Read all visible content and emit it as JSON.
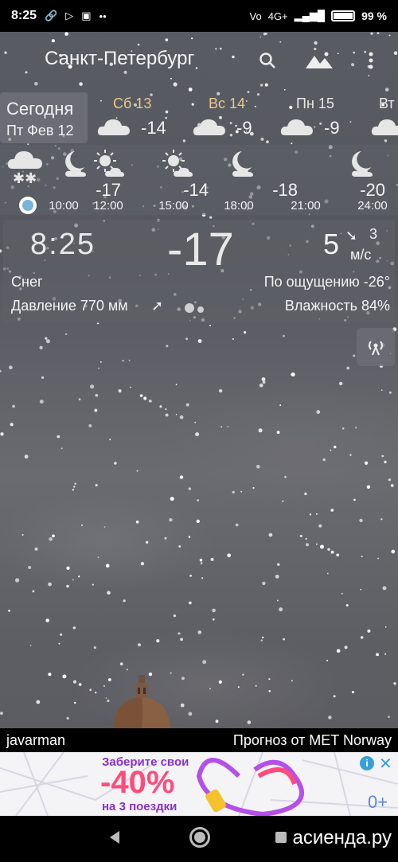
{
  "status_bar": {
    "time": "8:25",
    "network": "4G+",
    "battery": "99 %"
  },
  "toolbar": {
    "city": "Санкт-Петербург",
    "icons": [
      "search-icon",
      "landscape-icon",
      "more-vert-icon"
    ]
  },
  "days": {
    "today_label": "Сегодня",
    "today_date": "Пт Фев 12",
    "items": [
      {
        "name": "Сб 13",
        "temp": "-14",
        "weekend": true
      },
      {
        "name": "Вс 14",
        "temp": "-9",
        "weekend": true
      },
      {
        "name": "Пн 15",
        "temp": "-9",
        "weekend": false
      },
      {
        "name": "Вт",
        "temp": "",
        "weekend": false
      }
    ]
  },
  "hourly": [
    {
      "time": "10:00",
      "temp": "",
      "icon": "snow-cloud-icon"
    },
    {
      "time": "12:00",
      "temp": "-17",
      "icon": "sun-cloud-icon"
    },
    {
      "time": "15:00",
      "temp": "-14",
      "icon": "sun-cloud-icon"
    },
    {
      "time": "18:00",
      "temp": "",
      "icon": "moon-cloud-icon"
    },
    {
      "time": "21:00",
      "temp": "-18",
      "icon": "moon-cloud-icon"
    },
    {
      "time": "24:00",
      "temp": "-20",
      "icon": "moon-cloud-icon"
    }
  ],
  "current": {
    "time": "8:25",
    "temp": "-17",
    "wind_speed": "5",
    "wind_gust": "3",
    "wind_unit": "м/с",
    "condition": "Снег",
    "feels_like": "По ощущению -26°",
    "pressure": "Давление 770 мм",
    "humidity": "Влажность 84%"
  },
  "footer": {
    "user": "javarman",
    "source": "Прогноз от MET Norway"
  },
  "ad": {
    "line1": "Заберите свои",
    "line2": "-40%",
    "line3": "на 3 поездки",
    "age": "0+",
    "info": "i",
    "close": "✕"
  },
  "watermark": "асиенда.ру",
  "colors": {
    "weekend": "#e9c98a",
    "now_dot": "#7ab4d6",
    "ad_purple": "#8a2fd1",
    "ad_pink": "#ff4c7d"
  }
}
